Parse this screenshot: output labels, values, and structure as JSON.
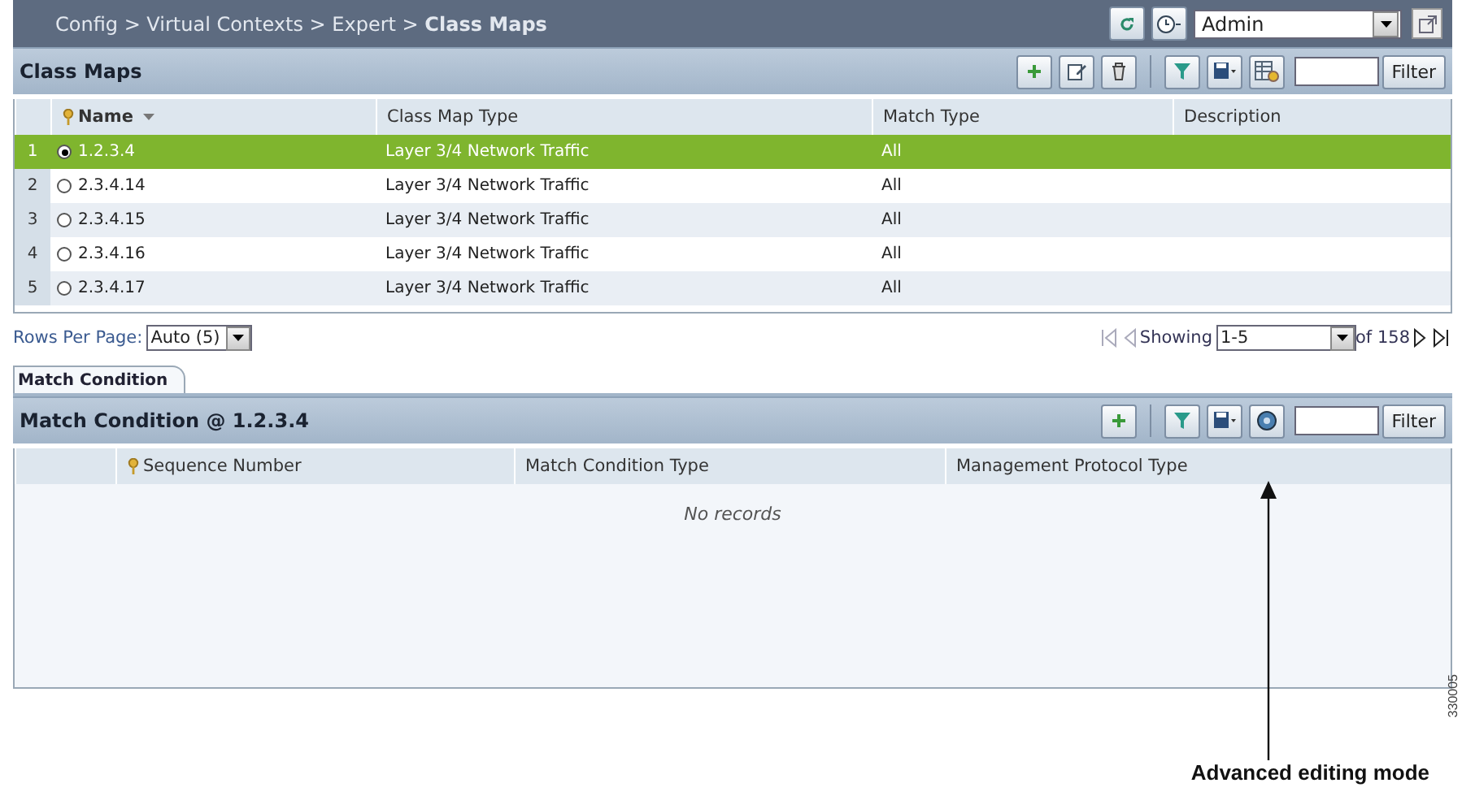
{
  "breadcrumb": "Config > Virtual Contexts > Expert > **Class Maps**",
  "context_select": {
    "value": "Admin"
  },
  "class_maps": {
    "title": "Class Maps",
    "filter_button": "Filter",
    "table": {
      "columns": [
        "Name",
        "Class Map Type",
        "Match Type",
        "Description"
      ],
      "rows": [
        {
          "index": "1",
          "name": "1.2.3.4",
          "type": "Layer 3/4 Network Traffic",
          "match": "All",
          "selected": true
        },
        {
          "index": "2",
          "name": "2.3.4.14",
          "type": "Layer 3/4 Network Traffic",
          "match": "All",
          "selected": false
        },
        {
          "index": "3",
          "name": "2.3.4.15",
          "type": "Layer 3/4 Network Traffic",
          "match": "All",
          "selected": false
        },
        {
          "index": "4",
          "name": "2.3.4.16",
          "type": "Layer 3/4 Network Traffic",
          "match": "All",
          "selected": false
        },
        {
          "index": "5",
          "name": "2.3.4.17",
          "type": "Layer 3/4 Network Traffic",
          "match": "All",
          "selected": false
        }
      ]
    }
  },
  "pager": {
    "rows_per_page_label": "Rows Per Page:",
    "rows_per_page": "Auto (5)",
    "showing_label": "Showing",
    "range": "1-5",
    "total": "of 158"
  },
  "tabs": [
    {
      "label": "Match Condition",
      "selected": true
    }
  ],
  "match_condition": {
    "title": "Match Condition @ 1.2.3.4",
    "filter_button": "Filter",
    "table": {
      "columns": [
        "Sequence Number",
        "Match Condition Type",
        "Management Protocol Type"
      ],
      "empty_text": "No records"
    }
  },
  "callout": {
    "label": "Advanced editing mode"
  },
  "figure_id": "330005"
}
